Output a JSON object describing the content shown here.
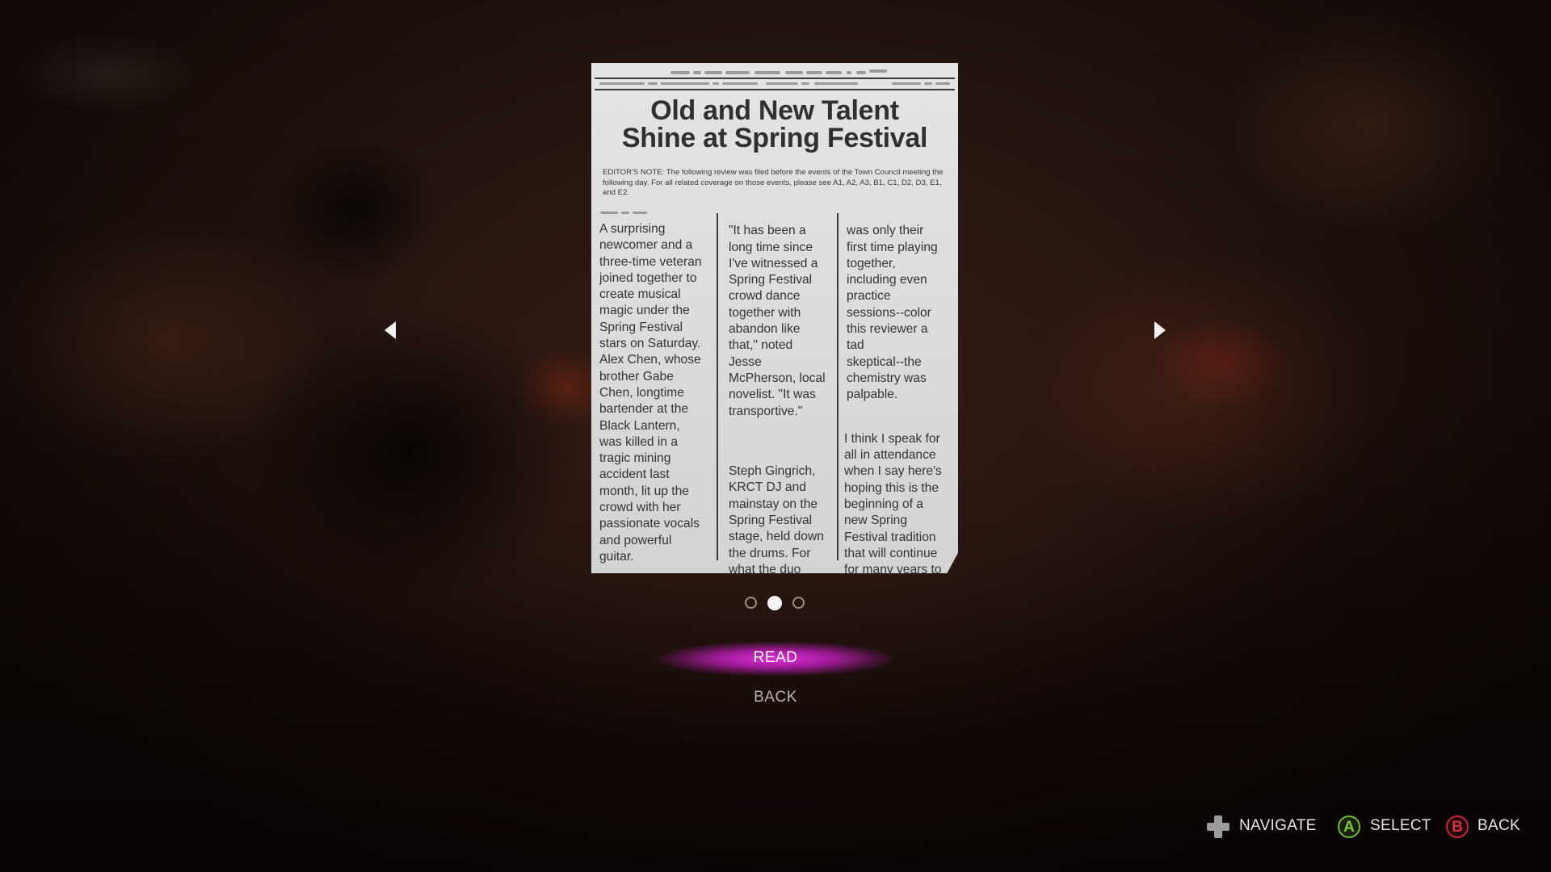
{
  "newspaper": {
    "headline_line1": "Old and New Talent",
    "headline_line2": "Shine at Spring Festival",
    "editor_note": "EDITOR'S NOTE: The following review was filed before the events of the Town Council meeting the following day. For all related coverage on those events, please see A1, A2, A3, B1, C1, D2, D3, E1, and E2.",
    "column1": "A surprising\nnewcomer and a\nthree-time veteran\njoined together to\ncreate musical\nmagic under the\nSpring Festival\nstars on Saturday.\nAlex Chen, whose\nbrother Gabe\nChen, longtime\nbartender at the\nBlack Lantern,\nwas killed in a\ntragic mining\naccident last\nmonth, lit up the\ncrowd with her\npassionate vocals\nand powerful\nguitar.",
    "column2_para1": "\"It has been a\nlong time since\nI've witnessed a\nSpring Festival\ncrowd dance\ntogether with\nabandon like\nthat,\" noted\nJesse\nMcPherson, local\nnovelist. \"It was\ntransportive.\"",
    "column2_para2": "Steph Gingrich,\nKRCT DJ and\nmainstay on the\nSpring Festival\nstage, held down\nthe drums. For\nwhat the duo\nclaimed",
    "column3_para1": "was only their\nfirst time playing\ntogether,\nincluding even\npractice\nsessions--color\nthis reviewer a\ntad\nskeptical--the\nchemistry was\npalpable.",
    "column3_para2": "I think I speak for\nall in attendance\nwhen I say here's\nhoping this is the\nbeginning of a\nnew Spring\nFestival tradition\nthat will continue\nfor many years to\ncome."
  },
  "pagination": {
    "total_pages": 3,
    "current_page": 2
  },
  "menu": {
    "read_label": "READ",
    "back_label": "BACK",
    "selected": "READ",
    "highlight_color": "#d832d4"
  },
  "footer": {
    "navigate_label": "NAVIGATE",
    "select_label": "SELECT",
    "back_label": "BACK",
    "select_button_glyph": "A",
    "back_button_glyph": "B",
    "navigate_icon": "dpad-icon",
    "select_color": "#7cc93a",
    "back_color": "#d8303f"
  }
}
